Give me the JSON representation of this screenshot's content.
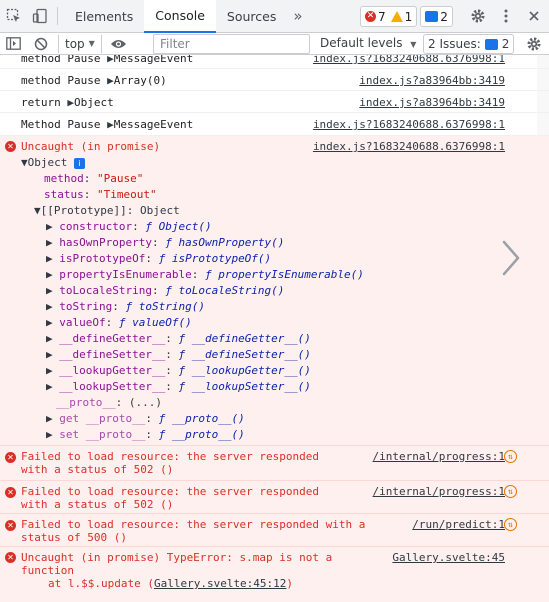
{
  "tabs": {
    "elements": "Elements",
    "console": "Console",
    "sources": "Sources",
    "more": "»"
  },
  "counters": {
    "errors": "7",
    "warnings": "1",
    "messages": "2"
  },
  "toolbar": {
    "context": "top",
    "filter_placeholder": "Filter",
    "levels": "Default levels",
    "issues_label": "2 Issues:",
    "issues_count": "2"
  },
  "log": [
    {
      "prefix": "method Pause ",
      "arrow": "▶",
      "value": "MessageEvent",
      "source": "index.js?1683240688.6376998:1"
    },
    {
      "prefix": "method Pause ",
      "arrow": "▶",
      "value": "Array(0)",
      "source": "index.js?a83964bb:3419"
    },
    {
      "prefix": "return ",
      "arrow": "▶",
      "value": "Object",
      "source": "index.js?a83964bb:3419"
    },
    {
      "prefix": "Method Pause ",
      "arrow": "▶",
      "value": "MessageEvent",
      "source": "index.js?1683240688.6376998:1"
    }
  ],
  "uncaught": {
    "title": "Uncaught (in promise)",
    "source": "index.js?1683240688.6376998:1",
    "object_label": "Object",
    "method_key": "method",
    "method_val": "\"Pause\"",
    "status_key": "status",
    "status_val": "\"Timeout\"",
    "prototype_label": "[[Prototype]]: Object",
    "proto_items": [
      {
        "key": "constructor",
        "val": "ƒ Object()"
      },
      {
        "key": "hasOwnProperty",
        "val": "ƒ hasOwnProperty()"
      },
      {
        "key": "isPrototypeOf",
        "val": "ƒ isPrototypeOf()"
      },
      {
        "key": "propertyIsEnumerable",
        "val": "ƒ propertyIsEnumerable()"
      },
      {
        "key": "toLocaleString",
        "val": "ƒ toLocaleString()"
      },
      {
        "key": "toString",
        "val": "ƒ toString()"
      },
      {
        "key": "valueOf",
        "val": "ƒ valueOf()"
      },
      {
        "key": "__defineGetter__",
        "val": "ƒ __defineGetter__()"
      },
      {
        "key": "__defineSetter__",
        "val": "ƒ __defineSetter__()"
      },
      {
        "key": "__lookupGetter__",
        "val": "ƒ __lookupGetter__()"
      },
      {
        "key": "__lookupSetter__",
        "val": "ƒ __lookupSetter__()"
      }
    ],
    "proto_dots_key": "__proto__",
    "proto_dots_val": "(...)",
    "get_proto": "get __proto__",
    "get_proto_val": "ƒ __proto__()",
    "set_proto": "set __proto__",
    "set_proto_val": "ƒ __proto__()"
  },
  "errors": [
    {
      "line1": "Failed to load resource: the server responded",
      "line2": "with a status of 502 ()",
      "source": "/internal/progress:1"
    },
    {
      "line1": "Failed to load resource: the server responded",
      "line2": "with a status of 502 ()",
      "source": "/internal/progress:1"
    },
    {
      "line1": "Failed to load resource: the server responded with a",
      "line2": "status of 500 ()",
      "source": "/run/predict:1"
    }
  ],
  "typeerror": {
    "line1": "Uncaught (in promise) TypeError: s.map is not a",
    "line2": "function",
    "line3_prefix": "at l.$$.update (",
    "line3_link": "Gallery.svelte:45:12",
    "line3_suffix": ")",
    "source": "Gallery.svelte:45"
  }
}
